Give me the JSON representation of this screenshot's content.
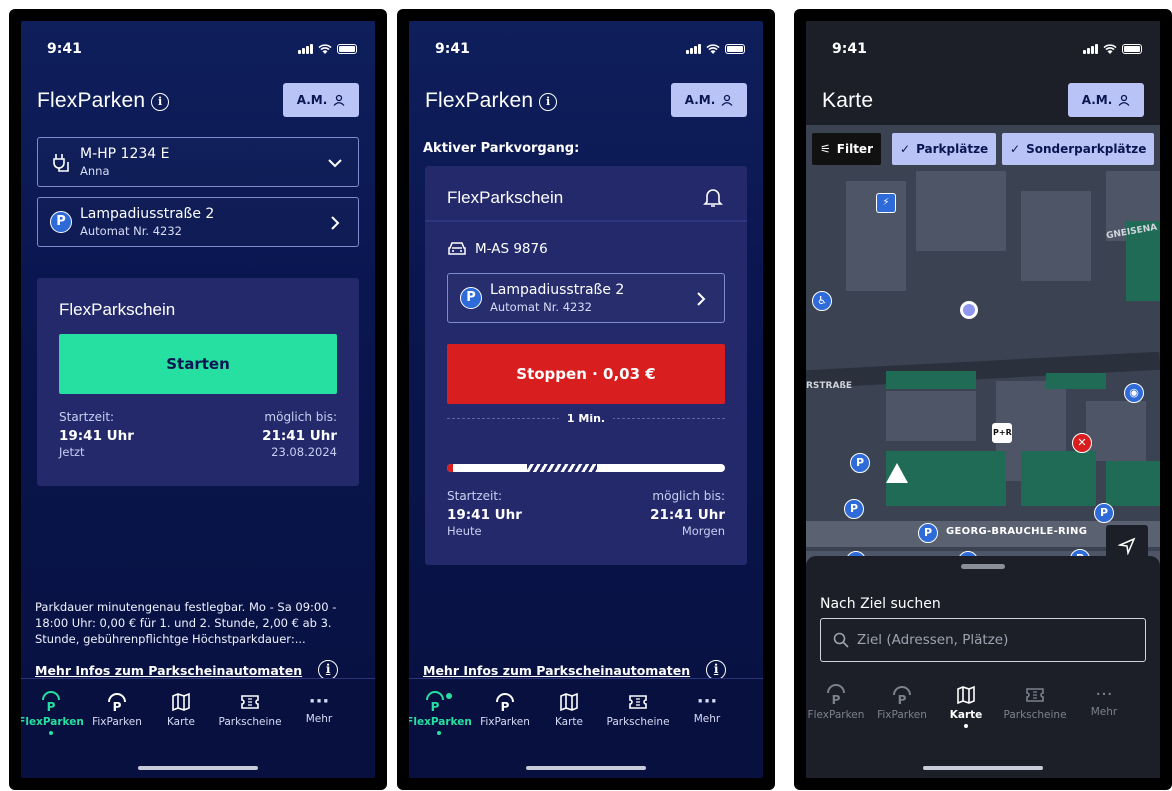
{
  "status": {
    "time": "9:41"
  },
  "screen1": {
    "title": "FlexParken",
    "avatar": "A.M.",
    "vehicle": {
      "plate": "M-HP 1234 E",
      "owner": "Anna"
    },
    "location": {
      "street": "Lampadiusstraße 2",
      "machine": "Automat Nr. 4232"
    },
    "panel_title": "FlexParkschein",
    "start_button": "Starten",
    "start_label": "Startzeit:",
    "start_time": "19:41 Uhr",
    "start_sub": "Jetzt",
    "until_label": "möglich bis:",
    "until_time": "21:41 Uhr",
    "until_sub": "23.08.2024",
    "footnote": "Parkdauer minutengenau festlegbar. Mo - Sa 09:00 - 18:00 Uhr: 0,00 € für 1. und 2. Stunde, 2,00 € ab 3. Stunde, gebührenpflichtge Höchstparkdauer:...",
    "more_link": "Mehr Infos zum Parkscheinautomaten"
  },
  "screen2": {
    "title": "FlexParken",
    "avatar": "A.M.",
    "section_label": "Aktiver Parkvorgang:",
    "panel_title": "FlexParkschein",
    "vehicle_plate": "M-AS 9876",
    "location": {
      "street": "Lampadiusstraße 2",
      "machine": "Automat Nr. 4232"
    },
    "stop_button": "Stoppen · 0,03 €",
    "duration": "1 Min.",
    "progress": 0.02,
    "start_label": "Startzeit:",
    "start_time": "19:41 Uhr",
    "start_sub": "Heute",
    "until_label": "möglich bis:",
    "until_time": "21:41 Uhr",
    "until_sub": "Morgen",
    "more_link": "Mehr Infos zum Parkscheinautomaten"
  },
  "screen3": {
    "title": "Karte",
    "avatar": "A.M.",
    "chips": {
      "filter": "Filter",
      "parking": "Parkplätze",
      "special": "Sonderparkplätze"
    },
    "streets": {
      "north": "GNEISENA",
      "west": "RSTRAßE",
      "south": "GEORG-BRAUCHLE-RING"
    },
    "search_label": "Nach Ziel suchen",
    "search_placeholder": "Ziel (Adressen, Plätze)",
    "pin_label": "P"
  },
  "tabs": [
    "FlexParken",
    "FixParken",
    "Karte",
    "Parkscheine",
    "Mehr"
  ],
  "colors": {
    "accent": "#25e0a0",
    "stop": "#d81e1e",
    "chip": "#b9c3f5"
  }
}
